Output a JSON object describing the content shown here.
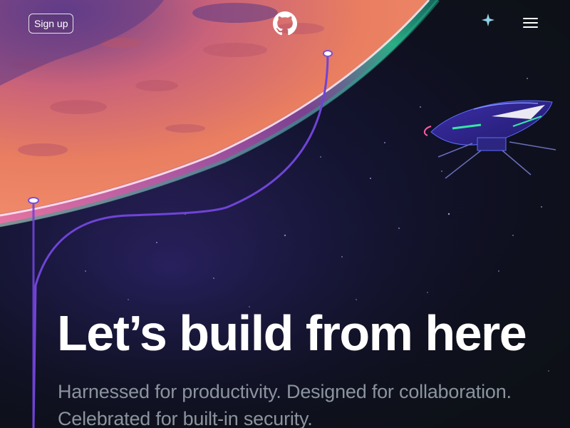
{
  "header": {
    "signup_label": "Sign up",
    "logo_icon": "github-mark-icon",
    "menu_icon": "hamburger-menu-icon"
  },
  "hero": {
    "title": "Let’s build from here",
    "subtitle": "Harnessed for productivity. Designed for collaboration. Celebrated for built-in security."
  },
  "illustration": {
    "planet": "mars-planet",
    "ship": "space-drone",
    "sparkle_icon": "sparkle-star-icon"
  },
  "colors": {
    "background": "#0d1117",
    "planet_orange": "#e8785e",
    "planet_glow": "#ff9fb8",
    "atmosphere_green": "#2fbf8f",
    "path_purple": "#7a4fd6",
    "subtitle_gray": "#8b949e",
    "text_white": "#ffffff"
  }
}
